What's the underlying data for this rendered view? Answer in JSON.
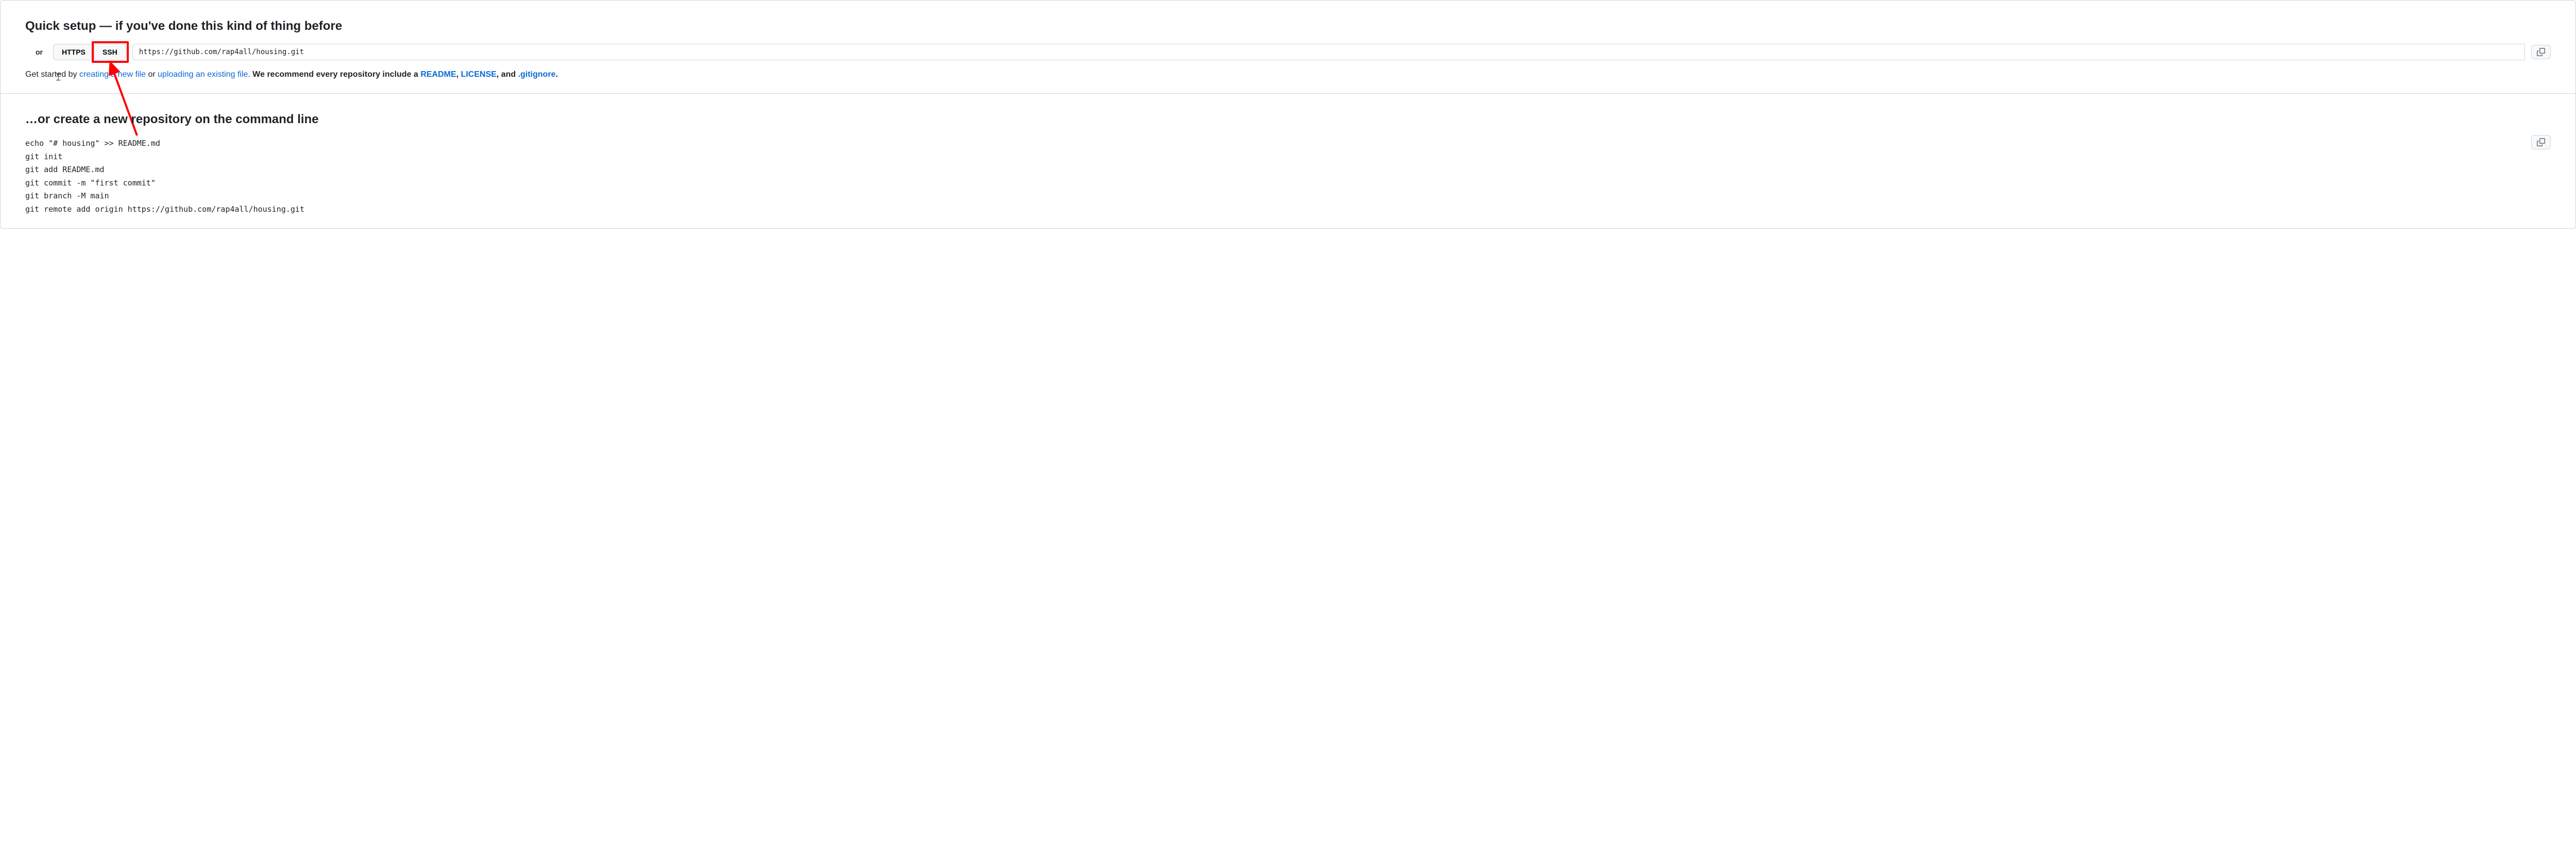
{
  "quickSetup": {
    "title": "Quick setup — if you've done this kind of thing before",
    "or": "or",
    "protoHttps": "HTTPS",
    "protoSsh": "SSH",
    "url": "https://github.com/rap4all/housing.git",
    "descPrefix": "Get started by ",
    "linkNewFile": "creating a new file",
    "descOr": " or ",
    "linkUpload": "uploading an existing file",
    "descPeriod": ". ",
    "descRecommendA": "We recommend every repository include a ",
    "linkReadme": "README",
    "descRecommendB": ", ",
    "linkLicense": "LICENSE",
    "descRecommendC": ", and ",
    "linkGitignore": ".gitignore",
    "descRecommendD": "."
  },
  "cmdLine": {
    "title": "…or create a new repository on the command line",
    "code": "echo \"# housing\" >> README.md\ngit init\ngit add README.md\ngit commit -m \"first commit\"\ngit branch -M main\ngit remote add origin https://github.com/rap4all/housing.git"
  }
}
